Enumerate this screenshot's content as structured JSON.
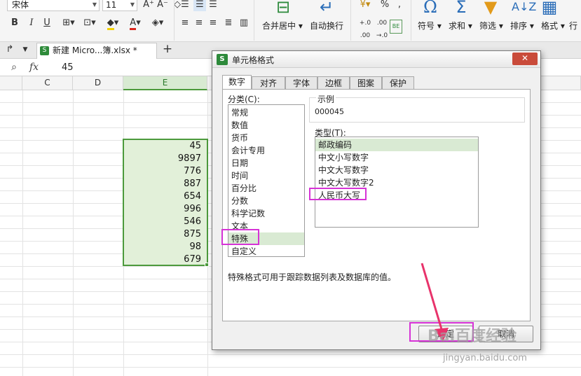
{
  "ribbon": {
    "font_name": "宋体",
    "font_size": "11",
    "font_grow": "A⁺",
    "font_shrink": "A⁻",
    "bold": "B",
    "italic": "I",
    "underline": "U",
    "merge_center": "合并居中",
    "wrap_text": "自动换行",
    "percent": "%",
    "symbol": "符号",
    "sum": "求和",
    "filter": "筛选",
    "sort": "排序",
    "format": "格式",
    "rowcol": "行"
  },
  "tabbar": {
    "file_tab": "新建 Micro...簿.xlsx *",
    "add_tab": "+"
  },
  "formula_bar": {
    "fx": "fx",
    "value": "45"
  },
  "grid": {
    "columns": [
      "C",
      "D",
      "E"
    ],
    "selected_column": "E",
    "values": [
      "45",
      "9897",
      "776",
      "887",
      "654",
      "996",
      "546",
      "875",
      "98",
      "679"
    ]
  },
  "dialog": {
    "title": "单元格格式",
    "icon_letter": "S",
    "close": "✕",
    "tabs": [
      "数字",
      "对齐",
      "字体",
      "边框",
      "图案",
      "保护"
    ],
    "active_tab": "数字",
    "category_label": "分类(C):",
    "categories": [
      "常规",
      "数值",
      "货币",
      "会计专用",
      "日期",
      "时间",
      "百分比",
      "分数",
      "科学记数",
      "文本",
      "特殊",
      "自定义"
    ],
    "selected_category": "特殊",
    "sample_label": "示例",
    "sample_value": "000045",
    "type_label": "类型(T):",
    "types": [
      "邮政编码",
      "中文小写数字",
      "中文大写数字",
      "中文大写数字2",
      "人民币大写"
    ],
    "selected_type": "邮政编码",
    "description": "特殊格式可用于跟踪数据列表及数据库的值。",
    "ok_button": "确定",
    "cancel_button": "取消"
  },
  "watermark": {
    "brand": "Bai百度经验",
    "url": "jingyan.baidu.com"
  },
  "colors": {
    "selection_fill": "#e2f0d9",
    "selection_border": "#4c9a3c",
    "highlight": "#d633d6",
    "arrow": "#e8336b",
    "close_button": "#c94b3a"
  }
}
